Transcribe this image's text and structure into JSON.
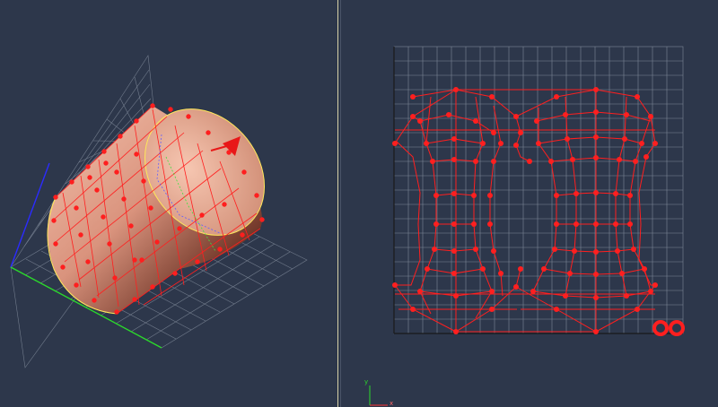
{
  "viewports": {
    "left": {
      "name": "perspective-view"
    },
    "right": {
      "name": "front-view"
    }
  },
  "axis_indicator": {
    "y_label": "y",
    "x_label": "x"
  },
  "colors": {
    "background": "#2d374b",
    "grid": "#7e8898",
    "control_lattice": "#ff1f1f",
    "surface_light": "#f1b49d",
    "surface_dark": "#4a2418",
    "axis_x": "#2bd92b",
    "axis_y": "#2b2bff",
    "outline_highlight": "#ffe85a"
  }
}
